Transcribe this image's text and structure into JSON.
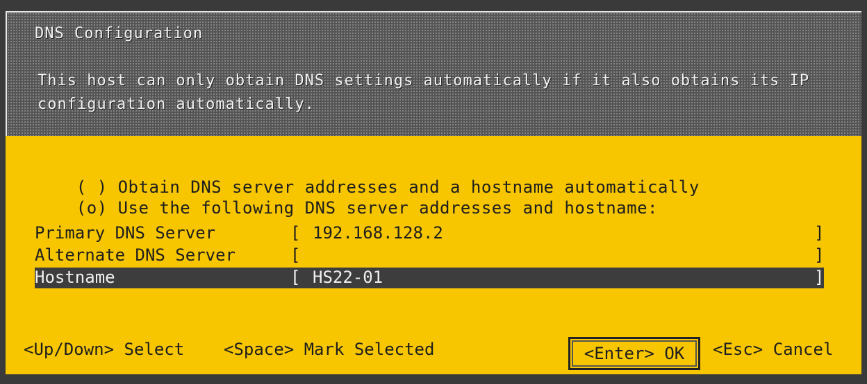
{
  "dialog": {
    "title": "DNS Configuration",
    "description": "This host can only obtain DNS settings automatically if it also obtains its IP configuration automatically."
  },
  "options": [
    {
      "marker": "( )",
      "label": "Obtain DNS server addresses and a hostname automatically"
    },
    {
      "marker": "(o)",
      "label": "Use the following DNS server addresses and hostname:"
    }
  ],
  "fields": {
    "primary_dns": {
      "label": "Primary DNS Server",
      "value": "192.168.128.2"
    },
    "alternate_dns": {
      "label": "Alternate DNS Server",
      "value": ""
    },
    "hostname": {
      "label": "Hostname",
      "value": "HS22-01"
    }
  },
  "brackets": {
    "open": "[",
    "close": "]"
  },
  "footer": {
    "updown": "<Up/Down> Select",
    "space": "<Space> Mark Selected",
    "enter": "<Enter> OK",
    "esc": "<Esc> Cancel"
  },
  "colors": {
    "accent": "#f7c600",
    "selection": "#3d3d3d",
    "header": "#555555"
  }
}
